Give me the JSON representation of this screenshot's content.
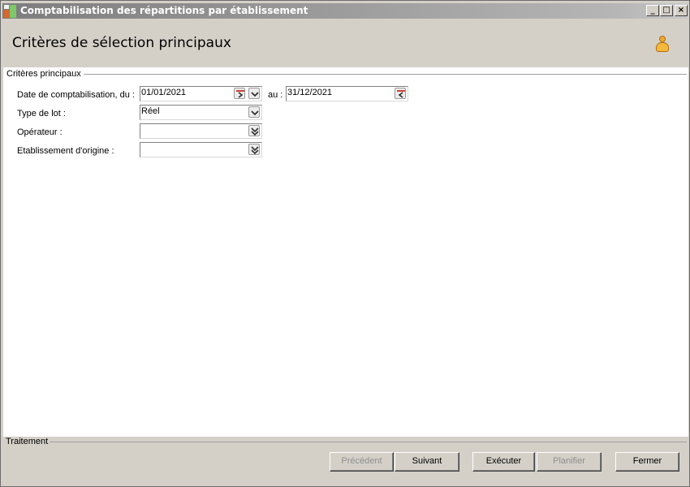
{
  "window": {
    "title": "Comptabilisation des répartitions par établissement",
    "controls": {
      "minimize": "_",
      "maximize": "□",
      "close": "×"
    }
  },
  "header": {
    "title": "Critères de sélection principaux",
    "user_icon": "user-icon"
  },
  "criteria": {
    "legend": "Critères principaux",
    "date_label": "Date de comptabilisation, du :",
    "date_from": "01/01/2021",
    "date_to_label": "au :",
    "date_to": "31/12/2021",
    "lot_type_label": "Type de lot :",
    "lot_type_value": "Réel",
    "operator_label": "Opérateur :",
    "operator_value": "",
    "establishment_label": "Etablissement d'origine :",
    "establishment_value": ""
  },
  "footer": {
    "legend": "Traitement",
    "buttons": {
      "previous": "Précédent",
      "next": "Suivant",
      "execute": "Exécuter",
      "schedule": "Planifier",
      "close": "Fermer"
    }
  },
  "colors": {
    "window_bg": "#d4d0c8",
    "title_gradient_start": "#7d7d7d",
    "calendar_icon_red": "#d04030",
    "user_icon_orange": "#f5b83c"
  }
}
